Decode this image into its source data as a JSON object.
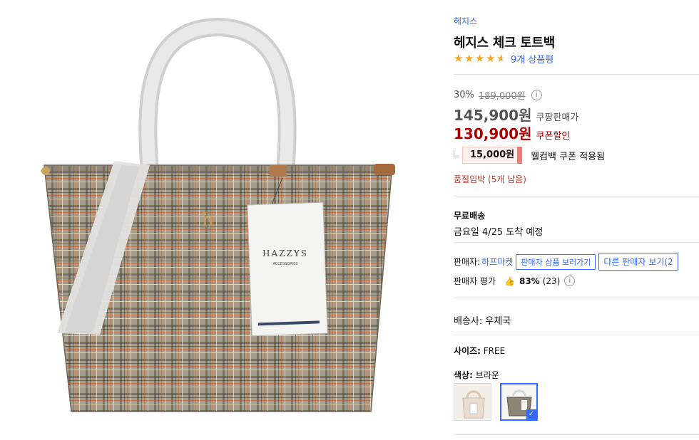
{
  "product": {
    "brand": "헤지스",
    "title": "헤지스 체크 토트백",
    "rating": 4.5,
    "reviews_text": "9개 상품평"
  },
  "pricing": {
    "discount": "30%",
    "original": "189,000원",
    "info_icon": "i",
    "sale_price": "145,900원",
    "sale_label": "쿠팡판매가",
    "coupon_price": "130,900원",
    "coupon_label": "쿠폰할인",
    "welcome_coupon": "15,000원",
    "welcome_text": "웰컴백 쿠폰 적용됨"
  },
  "stock": {
    "text": "품절임박 (5개 남음)"
  },
  "shipping": {
    "label": "무료배송",
    "date": "금요일 4/25 도착 예정"
  },
  "seller": {
    "label": "판매자:",
    "name": "하프마켓",
    "view_products": "판매자 상품 보러가기",
    "other_sellers": "다른 판매자 보기(2",
    "rating_label": "판매자 평가",
    "rating_pct": "83%",
    "rating_count": "(23)"
  },
  "delivery": {
    "courier": "배송사: 우체국"
  },
  "options": {
    "size_label": "사이즈:",
    "size_value": "FREE",
    "color_label": "색상:",
    "color_value": "브라운"
  },
  "image": {
    "tag_brand": "HAZZYS",
    "tag_sub": "ACCESSORIES",
    "logo_letter": "h"
  },
  "colors": {
    "accent": "#346aff",
    "coupon_red": "#ae0000",
    "star": "#f5a623"
  }
}
